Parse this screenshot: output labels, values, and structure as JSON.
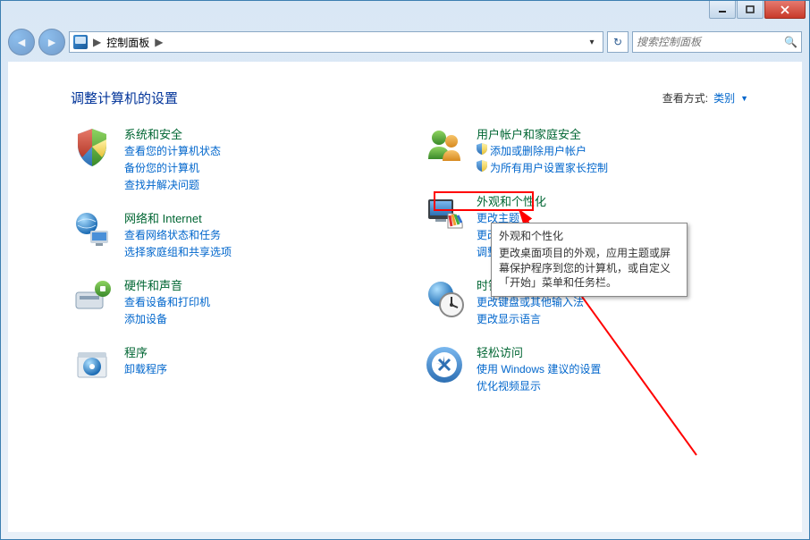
{
  "window": {
    "breadcrumb_label": "控制面板",
    "breadcrumb_sep": "▶"
  },
  "search": {
    "placeholder": "搜索控制面板"
  },
  "header": {
    "title": "调整计算机的设置",
    "view_label": "查看方式:",
    "view_value": "类别"
  },
  "cats_left": [
    {
      "title": "系统和安全",
      "icon": "security",
      "subs": [
        {
          "label": "查看您的计算机状态",
          "shield": false
        },
        {
          "label": "备份您的计算机",
          "shield": false
        },
        {
          "label": "查找并解决问题",
          "shield": false
        }
      ]
    },
    {
      "title": "网络和 Internet",
      "icon": "network",
      "subs": [
        {
          "label": "查看网络状态和任务",
          "shield": false
        },
        {
          "label": "选择家庭组和共享选项",
          "shield": false
        }
      ]
    },
    {
      "title": "硬件和声音",
      "icon": "hardware",
      "subs": [
        {
          "label": "查看设备和打印机",
          "shield": false
        },
        {
          "label": "添加设备",
          "shield": false
        }
      ]
    },
    {
      "title": "程序",
      "icon": "programs",
      "subs": [
        {
          "label": "卸载程序",
          "shield": false
        }
      ]
    }
  ],
  "cats_right": [
    {
      "title": "用户帐户和家庭安全",
      "icon": "users",
      "subs": [
        {
          "label": "添加或删除用户帐户",
          "shield": true
        },
        {
          "label": "为所有用户设置家长控制",
          "shield": true
        }
      ]
    },
    {
      "title": "外观和个性化",
      "icon": "appearance",
      "highlighted": true,
      "subs": [
        {
          "label": "更改主题",
          "shield": false
        },
        {
          "label": "更改桌面背景",
          "shield": false
        },
        {
          "label": "调整屏幕分辨率",
          "shield": false
        }
      ]
    },
    {
      "title": "时钟、语言和区域",
      "icon": "clock",
      "subs": [
        {
          "label": "更改键盘或其他输入法",
          "shield": false
        },
        {
          "label": "更改显示语言",
          "shield": false
        }
      ]
    },
    {
      "title": "轻松访问",
      "icon": "ease",
      "subs": [
        {
          "label": "使用 Windows 建议的设置",
          "shield": false
        },
        {
          "label": "优化视频显示",
          "shield": false
        }
      ]
    }
  ],
  "tooltip": {
    "title": "外观和个性化",
    "body": "更改桌面项目的外观，应用主题或屏幕保护程序到您的计算机，或自定义「开始」菜单和任务栏。"
  }
}
